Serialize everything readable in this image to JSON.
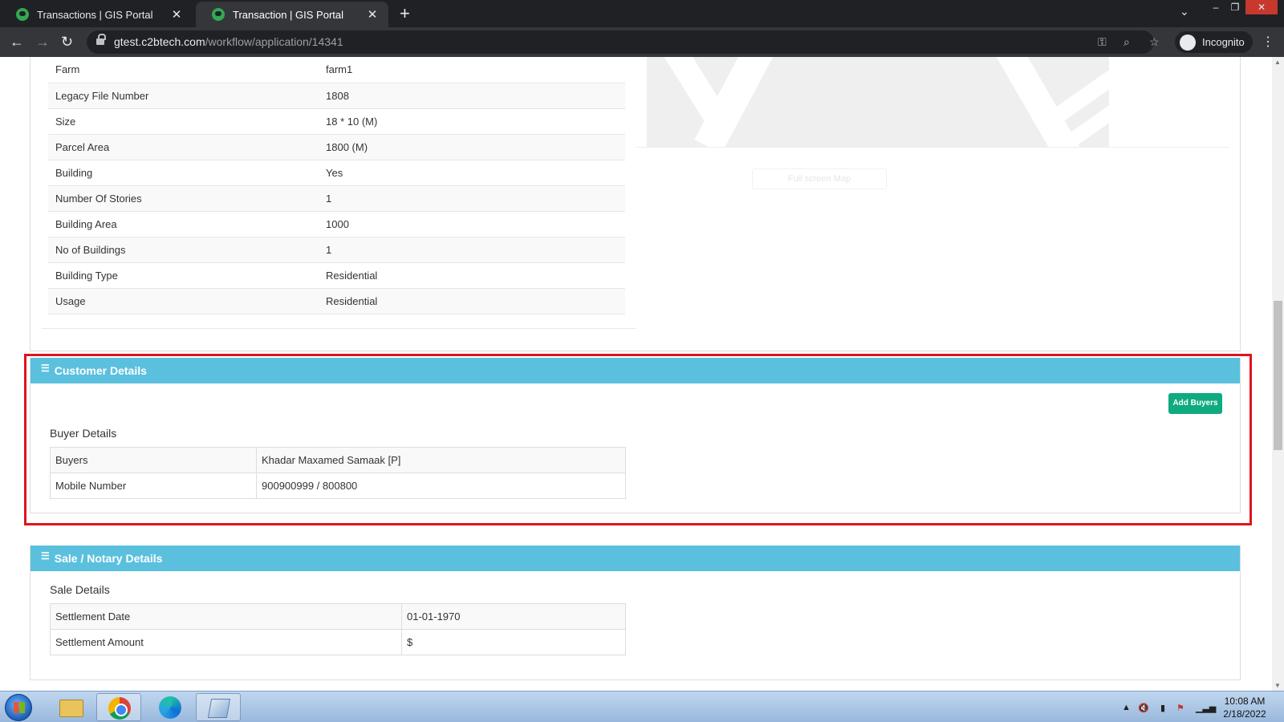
{
  "browser": {
    "tabs": [
      {
        "title": "Transactions | GIS Portal",
        "active": false
      },
      {
        "title": "Transaction | GIS Portal",
        "active": true
      }
    ],
    "url_host": "gtest.c2btech.com",
    "url_path": "/workflow/application/14341",
    "profile_label": "Incognito"
  },
  "property": {
    "rows": [
      {
        "label": "Farm",
        "value": "farm1"
      },
      {
        "label": "Legacy File Number",
        "value": "1808"
      },
      {
        "label": "Size",
        "value": "18 * 10 (M)"
      },
      {
        "label": "Parcel Area",
        "value": "1800 (M)"
      },
      {
        "label": "Building",
        "value": "Yes"
      },
      {
        "label": "Number Of Stories",
        "value": "1"
      },
      {
        "label": "Building Area",
        "value": "1000"
      },
      {
        "label": "No of Buildings",
        "value": "1"
      },
      {
        "label": "Building Type",
        "value": "Residential"
      },
      {
        "label": "Usage",
        "value": "Residential"
      }
    ],
    "map_button": "Full screen Map"
  },
  "customer": {
    "header": "Customer Details",
    "add_button": "Add Buyers",
    "subtitle": "Buyer Details",
    "rows": [
      {
        "label": "Buyers",
        "value": "Khadar Maxamed Samaak [P]"
      },
      {
        "label": "Mobile Number",
        "value": "900900999 / 800800"
      }
    ]
  },
  "sale": {
    "header": "Sale / Notary Details",
    "subtitle": "Sale Details",
    "rows": [
      {
        "label": "Settlement Date",
        "value": "01-01-1970"
      },
      {
        "label": "Settlement Amount",
        "value": "$"
      }
    ]
  },
  "taskbar": {
    "time": "10:08 AM",
    "date": "2/18/2022"
  },
  "colors": {
    "section_header": "#5bc0de",
    "add_button": "#0faa80",
    "highlight": "#e0141d"
  }
}
